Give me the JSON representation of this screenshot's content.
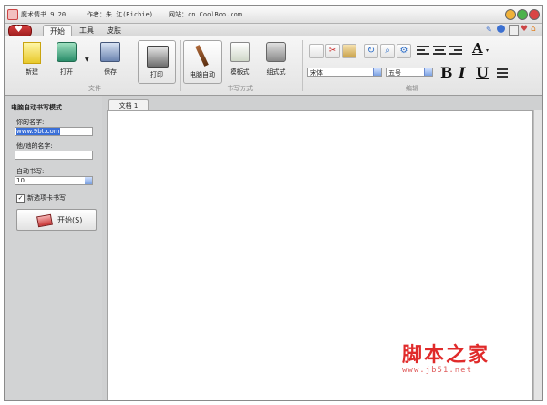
{
  "window": {
    "app_name": "魔术情书 9.20",
    "author": "作者：朱 江(Richie)",
    "website": "网站：cn.CoolBoo.com"
  },
  "menu": {
    "tabs": [
      "开始",
      "工具",
      "皮肤"
    ],
    "active_tab": "开始"
  },
  "ribbon": {
    "file_group": {
      "label": "文件",
      "buttons": [
        "新建",
        "打开",
        "保存",
        "打印"
      ]
    },
    "write_group": {
      "label": "书写方式",
      "buttons": [
        "电脑自动",
        "模板式",
        "组式式"
      ],
      "active": "电脑自动"
    },
    "edit_group": {
      "label": "编辑",
      "font": "宋体",
      "size": "五号",
      "bold": "B",
      "italic": "I",
      "underline": "U",
      "font_color": "A"
    }
  },
  "left_panel": {
    "title": "电脑自动书写模式",
    "your_name_label": "你的名字:",
    "your_name_value": "www.9bt.com",
    "other_name_label": "他/她的名字:",
    "other_name_value": "",
    "auto_write_label": "自动书写:",
    "auto_write_value": "10",
    "new_tab_checkbox": "新选项卡书写",
    "new_tab_checked": true,
    "start_button": "开始(S)"
  },
  "document": {
    "tab_label": "文档 1"
  },
  "watermark": {
    "text_cn": "脚本之家",
    "url": "www.jb51.net"
  },
  "colors": {
    "accent_red": "#c73434",
    "selection_blue": "#3a6fd8",
    "watermark_red": "#e02a2a"
  }
}
